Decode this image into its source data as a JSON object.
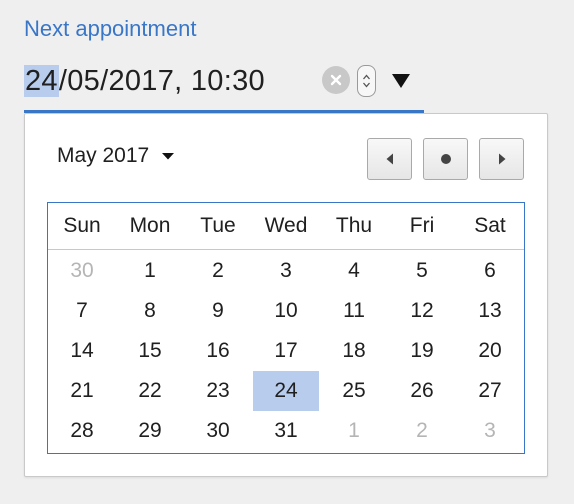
{
  "field_label": "Next appointment",
  "datetime": {
    "day": "24",
    "month": "05",
    "year": "2017",
    "time": "10:30"
  },
  "controls": {
    "clear_icon": "clear-x-icon",
    "spin_icon": "spin-up-down-icon",
    "dropdown_icon": "triangle-down-icon"
  },
  "picker": {
    "month_label": "May 2017",
    "nav": {
      "prev_icon": "triangle-left-icon",
      "today_icon": "dot-icon",
      "next_icon": "triangle-right-icon"
    },
    "weekdays": [
      "Sun",
      "Mon",
      "Tue",
      "Wed",
      "Thu",
      "Fri",
      "Sat"
    ],
    "weeks": [
      [
        {
          "d": "30",
          "other": true
        },
        {
          "d": "1"
        },
        {
          "d": "2"
        },
        {
          "d": "3"
        },
        {
          "d": "4"
        },
        {
          "d": "5"
        },
        {
          "d": "6"
        }
      ],
      [
        {
          "d": "7"
        },
        {
          "d": "8"
        },
        {
          "d": "9"
        },
        {
          "d": "10"
        },
        {
          "d": "11"
        },
        {
          "d": "12"
        },
        {
          "d": "13"
        }
      ],
      [
        {
          "d": "14"
        },
        {
          "d": "15"
        },
        {
          "d": "16"
        },
        {
          "d": "17"
        },
        {
          "d": "18"
        },
        {
          "d": "19"
        },
        {
          "d": "20"
        }
      ],
      [
        {
          "d": "21"
        },
        {
          "d": "22"
        },
        {
          "d": "23"
        },
        {
          "d": "24",
          "selected": true
        },
        {
          "d": "25"
        },
        {
          "d": "26"
        },
        {
          "d": "27"
        }
      ],
      [
        {
          "d": "28"
        },
        {
          "d": "29"
        },
        {
          "d": "30"
        },
        {
          "d": "31"
        },
        {
          "d": "1",
          "other": true
        },
        {
          "d": "2",
          "other": true
        },
        {
          "d": "3",
          "other": true
        }
      ]
    ]
  },
  "colors": {
    "accent": "#3a76c8",
    "selection": "#b8cdee",
    "muted": "#b5b5b5"
  }
}
